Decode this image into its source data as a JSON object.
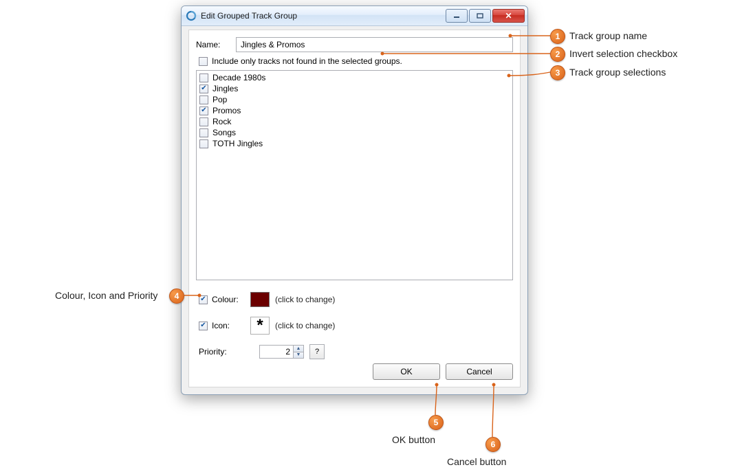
{
  "window": {
    "title": "Edit Grouped Track Group"
  },
  "labels": {
    "name": "Name:",
    "include_only": "Include only tracks not found in the selected groups.",
    "colour": "Colour:",
    "icon": "Icon:",
    "click_to_change": "(click to change)",
    "priority": "Priority:",
    "ok": "OK",
    "cancel": "Cancel",
    "help": "?"
  },
  "values": {
    "name": "Jingles & Promos",
    "include_only_checked": false,
    "colour_checked": true,
    "colour_hex": "#6b0000",
    "icon_checked": true,
    "icon_glyph": "*",
    "priority": "2"
  },
  "groups": [
    {
      "label": "Decade 1980s",
      "checked": false
    },
    {
      "label": "Jingles",
      "checked": true
    },
    {
      "label": "Pop",
      "checked": false
    },
    {
      "label": "Promos",
      "checked": true
    },
    {
      "label": "Rock",
      "checked": false
    },
    {
      "label": "Songs",
      "checked": false
    },
    {
      "label": "TOTH Jingles",
      "checked": false
    }
  ],
  "annotations": {
    "a1": "Track group name",
    "a2": "Invert selection checkbox",
    "a3": "Track group selections",
    "a4": "Colour, Icon and Priority",
    "a5": "OK button",
    "a6": "Cancel button"
  }
}
